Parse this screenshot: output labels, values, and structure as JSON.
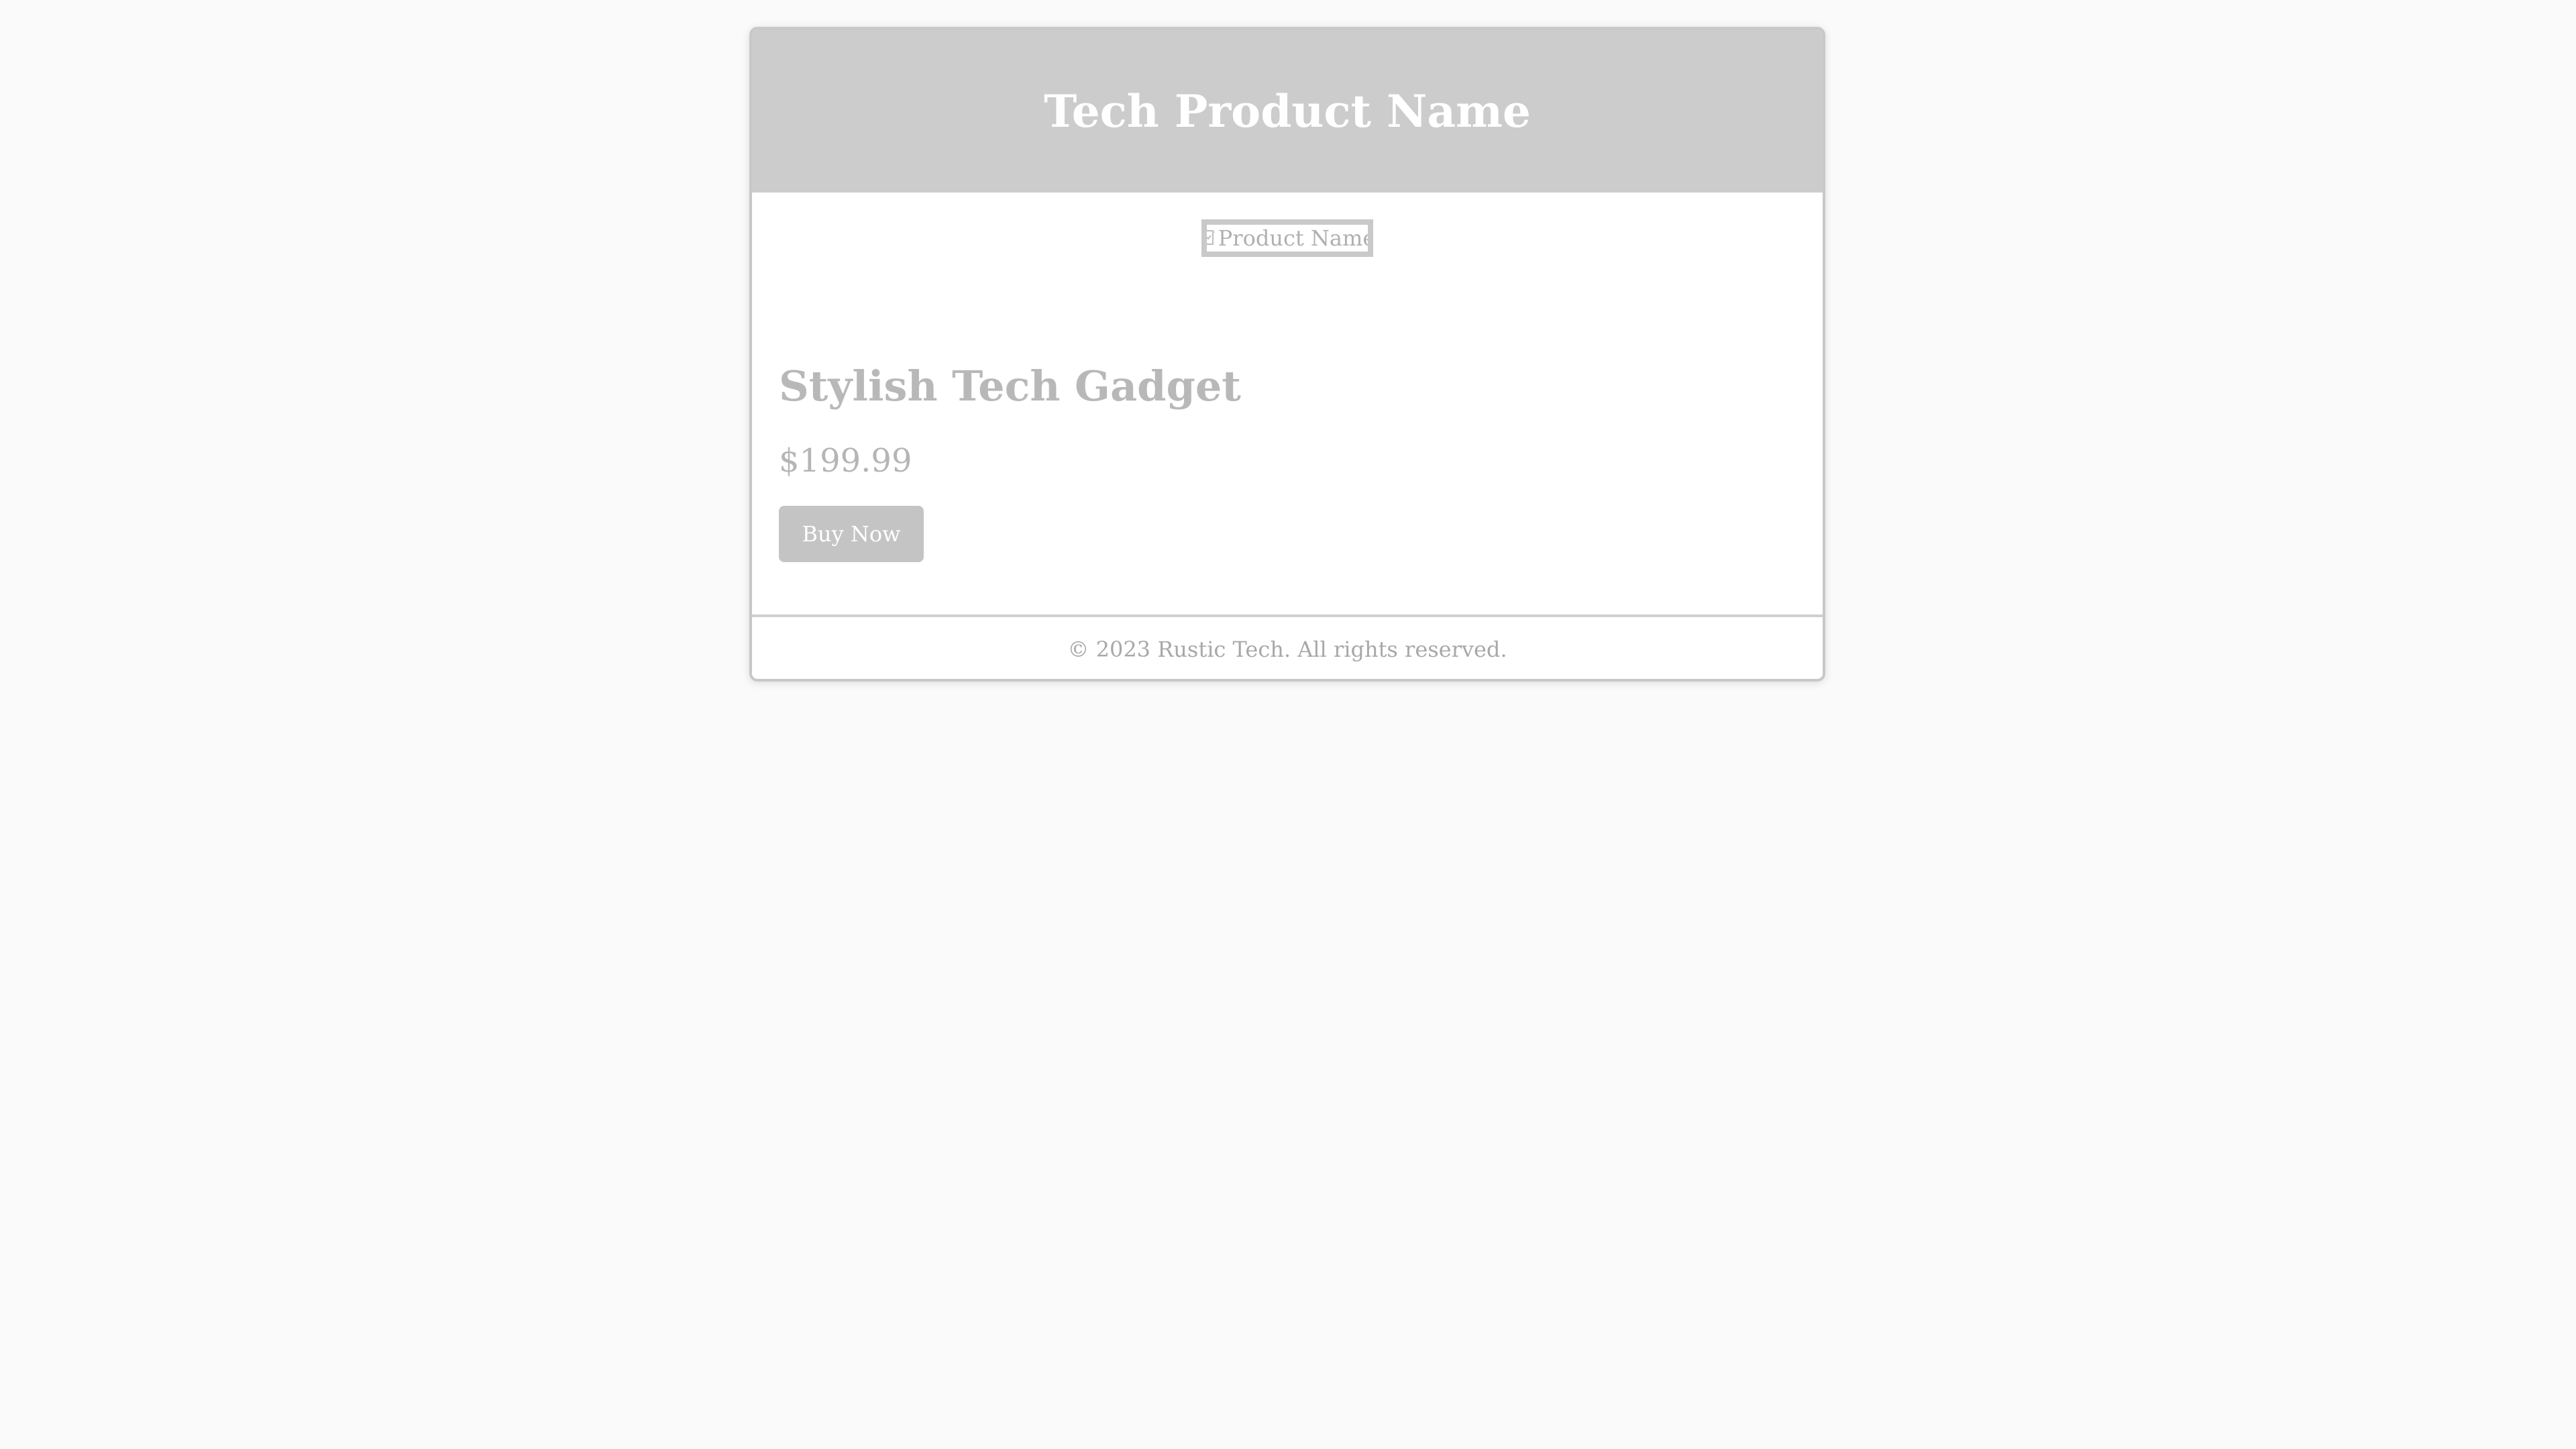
{
  "header": {
    "title": "Tech Product Name"
  },
  "product": {
    "image_alt": "Product Name",
    "image_icon": "broken-image-icon",
    "name": "Stylish Tech Gadget",
    "price": "$199.99",
    "buy_label": "Buy Now"
  },
  "footer": {
    "text": "© 2023 Rustic Tech. All rights reserved."
  },
  "colors": {
    "page_background": "#fafafa",
    "header_background": "#cccccc",
    "button_background": "#c4c4c4",
    "muted_text": "#b8b8b8"
  }
}
